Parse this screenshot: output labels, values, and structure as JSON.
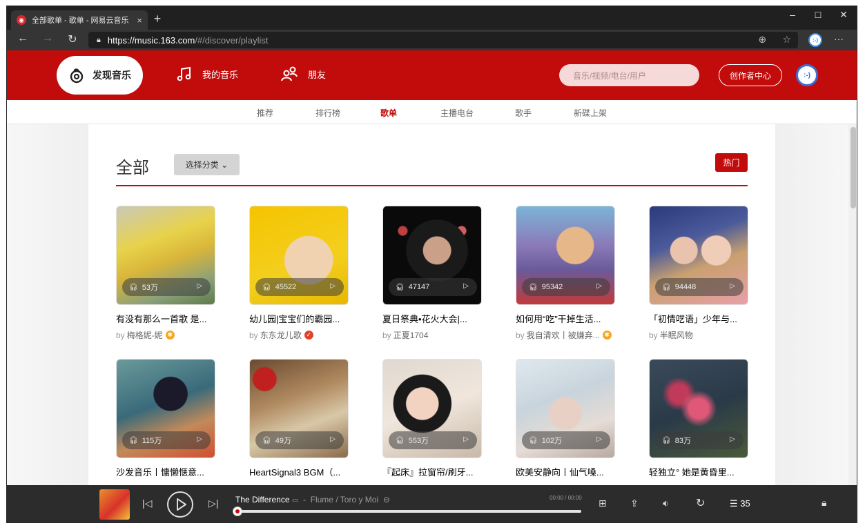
{
  "browser": {
    "tab_title": "全部歌单 - 歌单 - 网易云音乐",
    "tab_close": "×",
    "new_tab": "+",
    "url_host": "https://music.163.com",
    "url_path": "/#/discover/playlist",
    "win_minimize": "–",
    "win_maximize": "☐",
    "win_close": "✕",
    "profile_text": ":-)",
    "more": "···"
  },
  "header": {
    "logo_label": "发现音乐",
    "nav": [
      {
        "label": "我的音乐"
      },
      {
        "label": "朋友"
      }
    ],
    "search_placeholder": "音乐/视频/电台/用户",
    "creator_label": "创作者中心",
    "avatar_text": ":-)"
  },
  "subnav": [
    {
      "label": "推荐"
    },
    {
      "label": "排行榜"
    },
    {
      "label": "歌单",
      "active": true
    },
    {
      "label": "主播电台"
    },
    {
      "label": "歌手"
    },
    {
      "label": "新碟上架"
    }
  ],
  "category": {
    "title": "全部",
    "select_label": "选择分类 ⌄",
    "hot_label": "热门"
  },
  "playlists": [
    {
      "plays": "53万",
      "title": "有没有那么一首歌 是...",
      "by": "by",
      "author": "梅格妮-妮",
      "badge": "star"
    },
    {
      "plays": "45522",
      "title": "幼儿园|宝宝们的霸园...",
      "by": "by",
      "author": "东东龙儿歌",
      "badge": "check"
    },
    {
      "plays": "47147",
      "title": "夏日祭典•花火大会|...",
      "by": "by",
      "author": "正夏1704",
      "badge": ""
    },
    {
      "plays": "95342",
      "title": "如何用“吃”干掉生活...",
      "by": "by",
      "author": "我自清欢丨被嫌弃...",
      "badge": "star"
    },
    {
      "plays": "94448",
      "title": "「初情呓语」少年与...",
      "by": "by",
      "author": "半眠风物",
      "badge": ""
    },
    {
      "plays": "115万",
      "title": "沙发音乐丨慵懒惬意...",
      "by": "",
      "author": "",
      "badge": ""
    },
    {
      "plays": "49万",
      "title": "HeartSignal3 BGM（...",
      "by": "",
      "author": "",
      "badge": ""
    },
    {
      "plays": "553万",
      "title": "『起床』拉窗帘/刷牙...",
      "by": "",
      "author": "",
      "badge": ""
    },
    {
      "plays": "102万",
      "title": "欧美安静向丨仙气嗓...",
      "by": "",
      "author": "",
      "badge": ""
    },
    {
      "plays": "83万",
      "title": "轻独立° 她是黄昏里...",
      "by": "",
      "author": "",
      "badge": ""
    }
  ],
  "player": {
    "song_title": "The Difference",
    "separator": "-",
    "artist_1": "Flume",
    "artist_sep": "/",
    "artist_2": "Toro y Moi",
    "time": "00:00 / 00:00",
    "queue_count": "35",
    "progress": 0
  },
  "colors": {
    "brand": "#c20c0c"
  }
}
